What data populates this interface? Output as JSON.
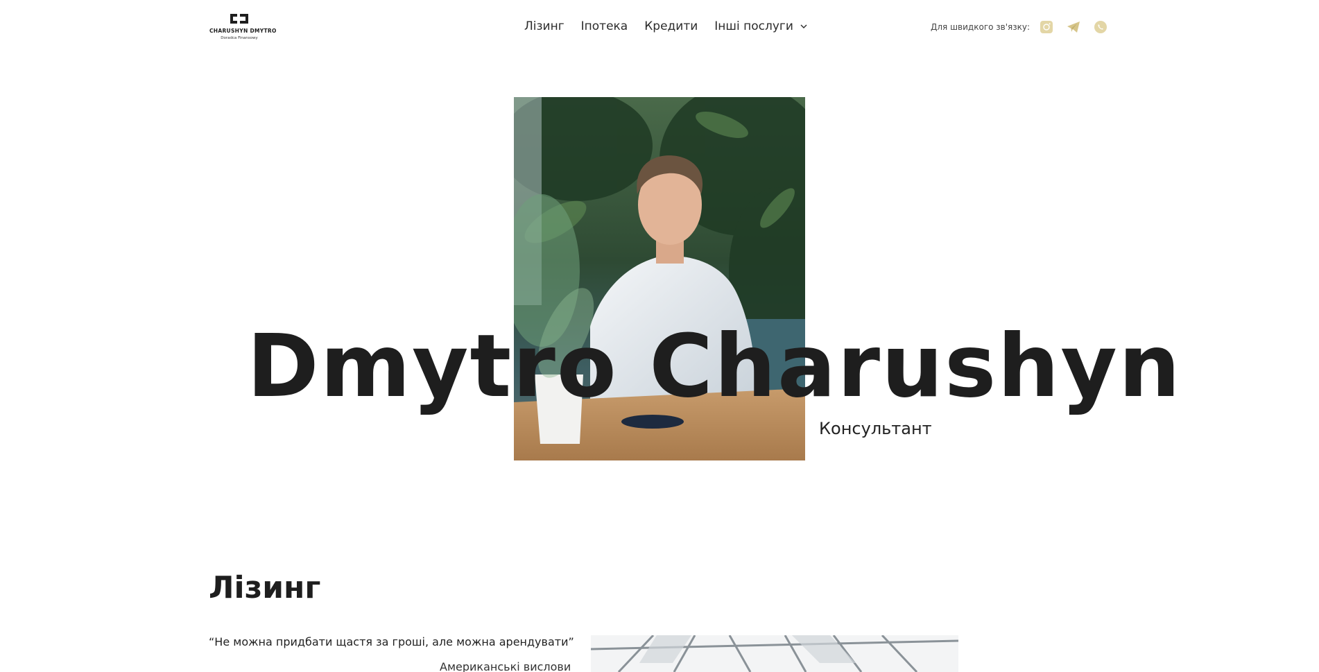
{
  "header": {
    "logo": {
      "name": "CHARUSHYN DMYTRO",
      "tagline": "Doradca Finansowy"
    },
    "nav": [
      {
        "label": "Лізинг"
      },
      {
        "label": "Іпотека"
      },
      {
        "label": "Кредити"
      },
      {
        "label": "Інші послуги"
      }
    ],
    "contact": {
      "label": "Для швидкого зв'язку:",
      "icons": [
        "instagram-icon",
        "telegram-icon",
        "whatsapp-icon"
      ]
    }
  },
  "hero": {
    "name": "Dmytro Charushyn",
    "role": "Консультант"
  },
  "leasing": {
    "title": "Лізинг",
    "quote": "“Не можна придбати щастя за гроші, але можна арендувати”",
    "quote_source": "Американські вислови"
  },
  "colors": {
    "accent_icon": "#d6c58a",
    "text": "#1e1e1e",
    "background": "#ffffff"
  }
}
